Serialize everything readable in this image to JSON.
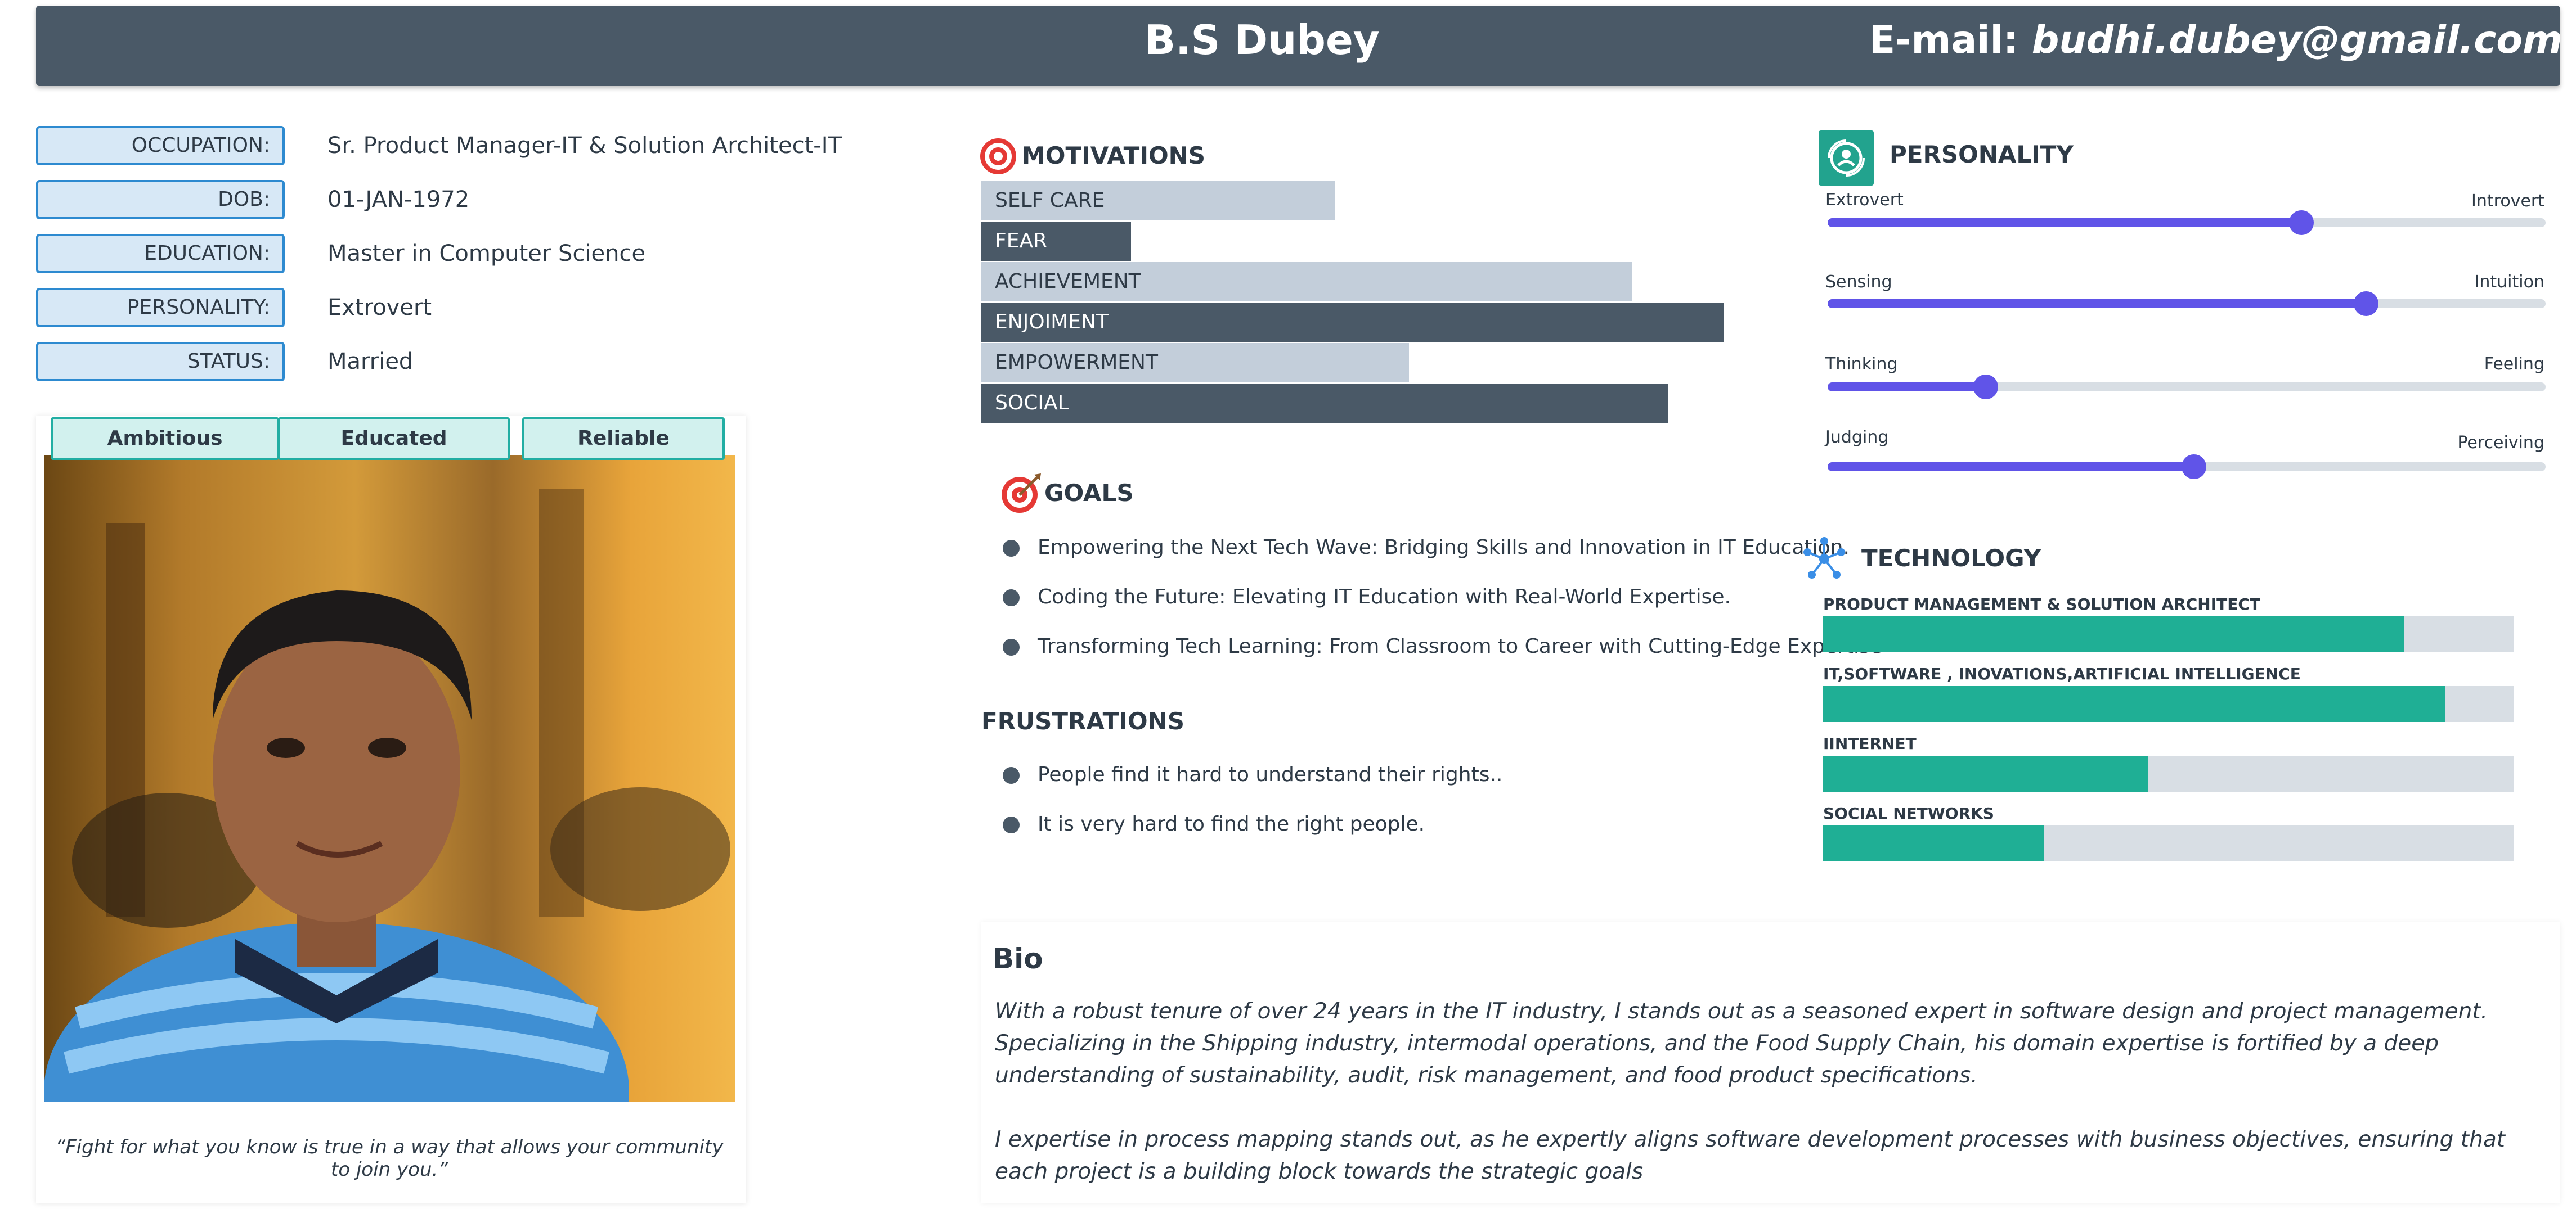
{
  "header": {
    "name": "B.S Dubey",
    "email_label": "E-mail:",
    "email": "budhi.dubey@gmail.com"
  },
  "info": [
    {
      "label": "OCCUPATION:",
      "value": "Sr. Product Manager-IT & Solution Architect-IT"
    },
    {
      "label": "DOB:",
      "value": "01-JAN-1972"
    },
    {
      "label": "EDUCATION:",
      "value": "Master in Computer Science"
    },
    {
      "label": "PERSONALITY:",
      "value": "Extrovert"
    },
    {
      "label": "STATUS:",
      "value": "Married"
    }
  ],
  "traits": [
    "Ambitious",
    "Educated",
    "Reliable"
  ],
  "quote": "“Fight for what you know is true in a way that allows your community to join you.”",
  "motivations": {
    "title": "MOTIVATIONS",
    "items": [
      {
        "label": "SELF CARE",
        "value": 0.475
      },
      {
        "label": "FEAR",
        "value": 0.2
      },
      {
        "label": "ACHIEVEMENT",
        "value": 0.875
      },
      {
        "label": "ENJOIMENT",
        "value": 1.0
      },
      {
        "label": "EMPOWERMENT",
        "value": 0.575
      },
      {
        "label": "SOCIAL",
        "value": 0.925
      }
    ]
  },
  "goals": {
    "title": "GOALS",
    "items": [
      "Empowering the Next Tech Wave: Bridging Skills and Innovation in IT Education.",
      "Coding the Future: Elevating IT Education with Real-World Expertise.",
      "Transforming Tech Learning: From Classroom to Career with Cutting-Edge Expertise"
    ]
  },
  "frustrations": {
    "title": "FRUSTRATIONS",
    "items": [
      "People find it hard to understand their rights..",
      "It is very hard to find the right people."
    ]
  },
  "personality": {
    "title": "PERSONALITY",
    "scales": [
      {
        "left": "Extrovert",
        "right": "Introvert",
        "value": 0.66
      },
      {
        "left": "Sensing",
        "right": "Intuition",
        "value": 0.75
      },
      {
        "left": "Thinking",
        "right": "Feeling",
        "value": 0.22
      },
      {
        "left": "Judging",
        "right": "Perceiving",
        "value": 0.51
      }
    ]
  },
  "technology": {
    "title": "TECHNOLOGY",
    "items": [
      {
        "label": "PRODUCT MANAGEMENT & SOLUTION ARCHITECT",
        "value": 0.84
      },
      {
        "label": "IT,SOFTWARE , INOVATIONS,ARTIFICIAL INTELLIGENCE",
        "value": 0.9
      },
      {
        "label": "IINTERNET",
        "value": 0.47
      },
      {
        "label": "SOCIAL NETWORKS",
        "value": 0.32
      }
    ]
  },
  "bio": {
    "title": "Bio",
    "paragraphs": [
      "With a robust tenure of over 24 years in the IT industry, I stands out as a seasoned expert in software design and project management. Specializing in the Shipping industry, intermodal operations, and the Food Supply Chain, his domain expertise is fortified by a deep understanding of sustainability, audit, risk management, and food product specifications.",
      "I expertise in process mapping stands out, as he expertly aligns software development processes with business objectives, ensuring that each project is a building block towards the strategic goals"
    ]
  },
  "colors": {
    "header_bg": "#4a5967",
    "slider_accent": "#6054e8",
    "tech_accent": "#1faf95",
    "trait_accent": "#22aea3",
    "info_border": "#2d8ad0"
  }
}
